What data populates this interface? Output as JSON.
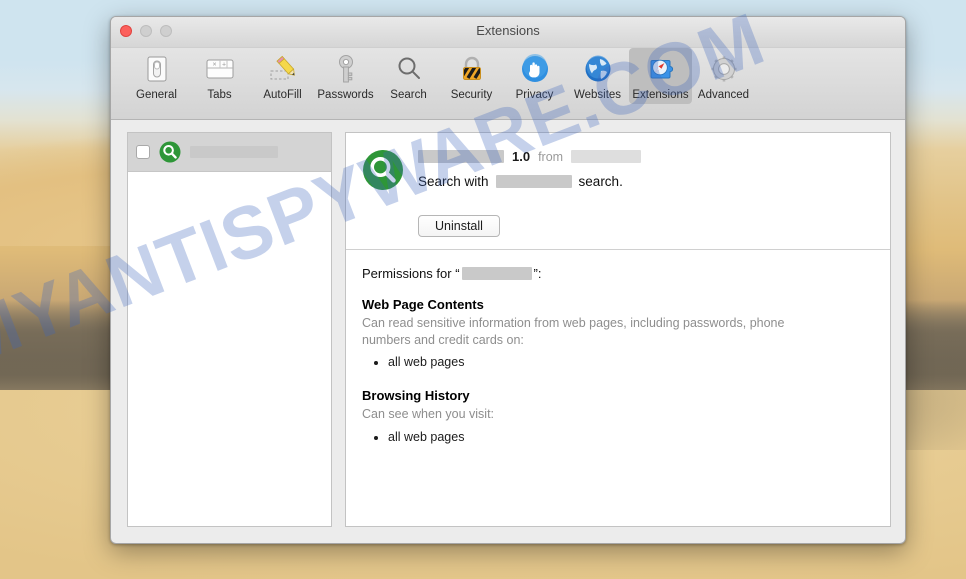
{
  "desktop": {
    "wallpaper_name": "desert-dunes-wallpaper",
    "watermark": "MYANTISPYWARE.COM"
  },
  "window": {
    "title": "Extensions",
    "traffic_lights": {
      "close": "close-button",
      "minimize": "minimize-button",
      "maximize": "maximize-button"
    }
  },
  "toolbar": {
    "items": [
      {
        "label": "General",
        "icon": "general-icon",
        "selected": false
      },
      {
        "label": "Tabs",
        "icon": "tabs-icon",
        "selected": false
      },
      {
        "label": "AutoFill",
        "icon": "autofill-icon",
        "selected": false
      },
      {
        "label": "Passwords",
        "icon": "passwords-icon",
        "selected": false
      },
      {
        "label": "Search",
        "icon": "search-icon",
        "selected": false
      },
      {
        "label": "Security",
        "icon": "security-icon",
        "selected": false
      },
      {
        "label": "Privacy",
        "icon": "privacy-icon",
        "selected": false
      },
      {
        "label": "Websites",
        "icon": "websites-icon",
        "selected": false
      },
      {
        "label": "Extensions",
        "icon": "extensions-icon",
        "selected": true
      },
      {
        "label": "Advanced",
        "icon": "advanced-icon",
        "selected": false
      }
    ]
  },
  "sidebar": {
    "items": [
      {
        "enabled": false,
        "icon": "green-magnifier-icon",
        "name_redacted": true,
        "name": ""
      }
    ]
  },
  "detail": {
    "icon": "green-magnifier-icon",
    "name_redacted": true,
    "name": "",
    "version": "1.0",
    "from_label": "from",
    "author_redacted": true,
    "author": "",
    "description_prefix": "Search with",
    "description_suffix": "search.",
    "description_redacted": true,
    "uninstall_label": "Uninstall",
    "permissions": {
      "heading_prefix": "Permissions for “",
      "heading_suffix": "”:",
      "subject_redacted": true,
      "subject": "",
      "groups": [
        {
          "title": "Web Page Contents",
          "text": "Can read sensitive information from web pages, including passwords, phone numbers and credit cards on:",
          "items": [
            "all web pages"
          ]
        },
        {
          "title": "Browsing History",
          "text": "Can see when you visit:",
          "items": [
            "all web pages"
          ]
        }
      ]
    }
  },
  "colors": {
    "accent_green": "#2E9638",
    "close_red": "#FC605C",
    "selected_tab": "#BEBEBE",
    "watermark_blue": "#3E68BE",
    "redaction_gray": "#C9C9C9"
  }
}
